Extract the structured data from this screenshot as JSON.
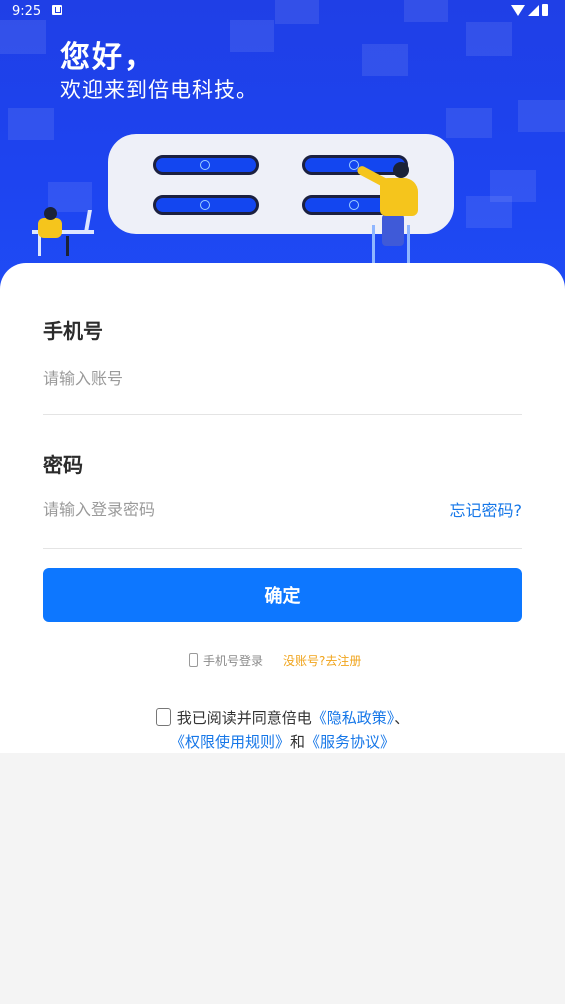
{
  "status_bar": {
    "time": "9:25"
  },
  "hero": {
    "greeting": "您好，",
    "welcome": "欢迎来到倍电科技。"
  },
  "form": {
    "phone_label": "手机号",
    "phone_placeholder": "请输入账号",
    "password_label": "密码",
    "password_placeholder": "请输入登录密码",
    "forgot_password": "忘记密码?",
    "confirm_button": "确定"
  },
  "alt_links": {
    "phone_login": "手机号登录",
    "register": "没账号?去注册"
  },
  "agreement": {
    "prefix": "我已阅读并同意倍电",
    "privacy_policy": "《隐私政策》",
    "separator": "、",
    "permission_rules": "《权限使用规则》",
    "and": "和",
    "service_agreement": "《服务协议》"
  },
  "colors": {
    "hero_blue": "#1f3fe6",
    "primary": "#0d77ff",
    "link": "#1677e8",
    "register": "#f0a41c"
  },
  "icons": [
    "wifi-icon",
    "signal-icon",
    "battery-icon",
    "phone-icon",
    "checkbox-icon"
  ]
}
